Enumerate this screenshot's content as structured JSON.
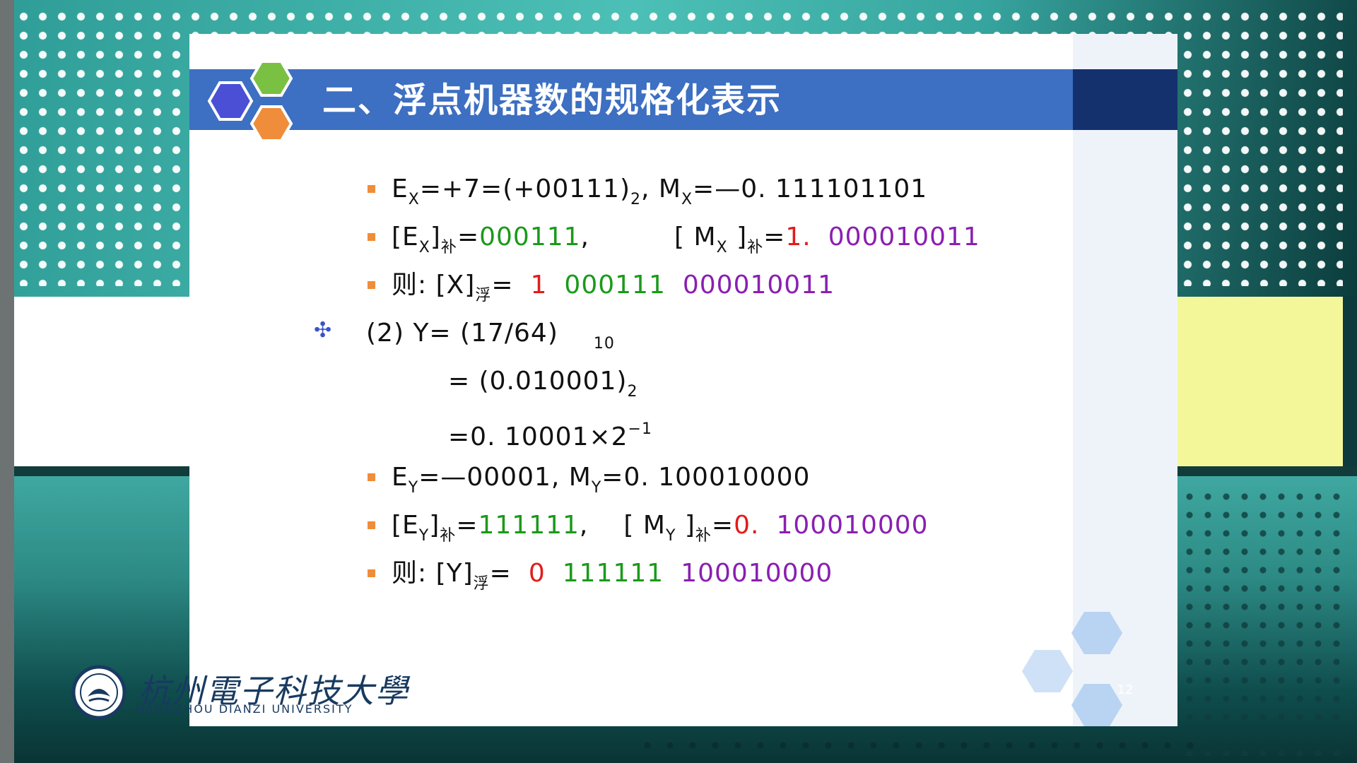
{
  "slide": {
    "title": "二、浮点机器数的规格化表示",
    "page_number": "12"
  },
  "lines": {
    "l1": {
      "e": "E",
      "e_sub": "X",
      "e_rest": "=+7=(+00111)",
      "e_sub2": "2",
      "m_sep": ",  M",
      "m_sub": "X",
      "m_rest": "=—0.  111101101"
    },
    "l2": {
      "open": "[E",
      "sub": "X",
      "close": "]",
      "bu": "补",
      "eq": "=",
      "val": "000111",
      "comma": ",",
      "mopen": "[ M",
      "msub": "X",
      "mclose": " ]",
      "mbu": "补",
      "meq": "=",
      "msign": "1.",
      "mval": "000010011"
    },
    "l3": {
      "prefix": "则: [X]",
      "fu": "浮",
      "eq": "=",
      "sign": "1",
      "exp": "000111",
      "mant": "000010011"
    },
    "l4": {
      "text": "(2) Y= (17/64)",
      "sub": "10"
    },
    "l5": {
      "text": "= (0.010001)",
      "sub": "2"
    },
    "l6": {
      "text": "=0.  10001×2",
      "sup": "−1"
    },
    "l7": {
      "e": "E",
      "e_sub": "Y",
      "e_rest": "=—00001, M",
      "m_sub": "Y",
      "m_rest": "=0.  100010000"
    },
    "l8": {
      "open": "[E",
      "sub": "Y",
      "close": "]",
      "bu": "补",
      "eq": "=",
      "val": "111111",
      "comma": ",",
      "mopen": "[ M",
      "msub": "Y",
      "mclose": " ]",
      "mbu": "补",
      "meq": "=",
      "msign": "0.",
      "mval": "100010000"
    },
    "l9": {
      "prefix": "则: [Y]",
      "fu": "浮",
      "eq": "=",
      "sign": "0",
      "exp": "111111",
      "mant": "100010000"
    }
  },
  "logo": {
    "cn": "杭州電子科技大學",
    "en": "HANGZHOU DIANZI UNIVERSITY"
  },
  "colors": {
    "title_bar": "#3d6fc2",
    "bullet": "#ef8d3a",
    "green": "#1a9a1a",
    "red": "#e31b1b",
    "purple": "#8a1fb1"
  }
}
